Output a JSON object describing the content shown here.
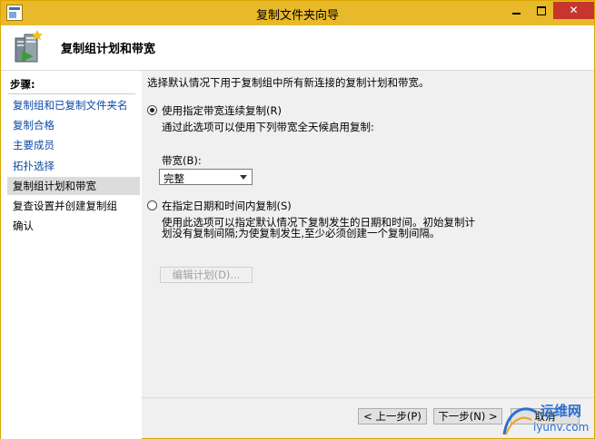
{
  "window": {
    "title": "复制文件夹向导"
  },
  "header": {
    "title": "复制组计划和带宽"
  },
  "steps": {
    "heading": "步骤:",
    "items": [
      {
        "label": "复制组和已复制文件夹名"
      },
      {
        "label": "复制合格"
      },
      {
        "label": "主要成员"
      },
      {
        "label": "拓扑选择"
      },
      {
        "label": "复制组计划和带宽"
      },
      {
        "label": "复查设置并创建复制组"
      },
      {
        "label": "确认"
      }
    ]
  },
  "main": {
    "intro": "选择默认情况下用于复制组中所有新连接的复制计划和带宽。",
    "option_full": {
      "label": "使用指定带宽连续复制(R)",
      "description": "通过此选项可以使用下列带宽全天候启用复制:",
      "bandwidth_label": "带宽(B):",
      "bandwidth_value": "完整"
    },
    "option_schedule": {
      "label": "在指定日期和时间内复制(S)",
      "description_line1": "使用此选项可以指定默认情况下复制发生的日期和时间。初始复制计",
      "description_line2": "划没有复制间隔;为使复制发生,至少必须创建一个复制间隔。",
      "edit_button": "编辑计划(D)..."
    }
  },
  "footer": {
    "back_button": "< 上一步(P)",
    "next_button": "下一步(N) >",
    "cancel_button": "取消"
  },
  "watermark": {
    "text": "运维网",
    "url": "iyunv.com"
  }
}
